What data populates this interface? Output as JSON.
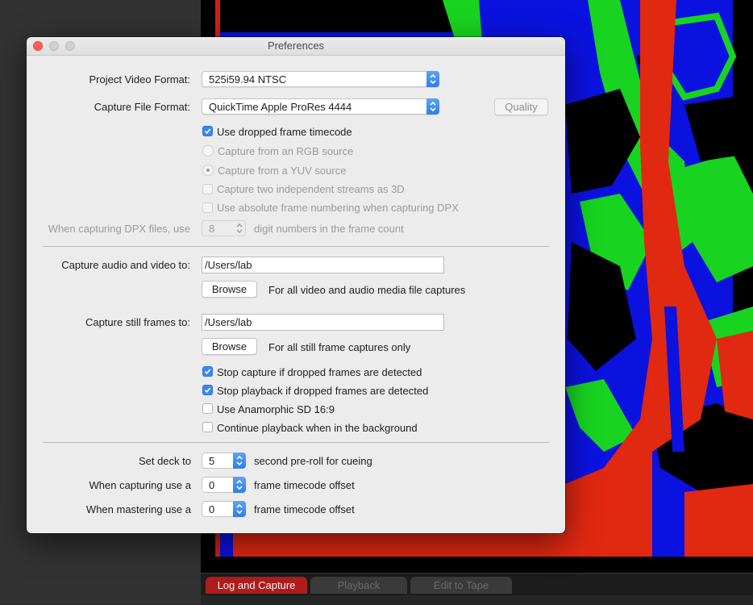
{
  "window": {
    "title": "Preferences"
  },
  "format": {
    "project_video_label": "Project Video Format:",
    "project_video_value": "525i59.94 NTSC",
    "capture_file_label": "Capture File Format:",
    "capture_file_value": "QuickTime Apple ProRes 4444",
    "quality_button": "Quality"
  },
  "options": {
    "dropped_frame_timecode": {
      "label": "Use dropped frame timecode",
      "checked": true,
      "enabled": true
    },
    "rgb_source": {
      "label": "Capture from an RGB source",
      "selected": false,
      "enabled": false
    },
    "yuv_source": {
      "label": "Capture from a YUV source",
      "selected": true,
      "enabled": false
    },
    "streams_3d": {
      "label": "Capture two independent streams as 3D",
      "checked": false,
      "enabled": false
    },
    "absolute_numbering": {
      "label": "Use absolute frame numbering when capturing DPX",
      "checked": false,
      "enabled": false
    }
  },
  "dpx": {
    "prefix": "When capturing DPX files, use",
    "digits": "8",
    "suffix": "digit numbers in the frame count"
  },
  "capture_paths": {
    "av_label": "Capture audio and video to:",
    "av_path": "/Users/lab",
    "av_browse": "Browse",
    "av_hint": "For all video and audio media file captures",
    "still_label": "Capture still frames to:",
    "still_path": "/Users/lab",
    "still_browse": "Browse",
    "still_hint": "For all still frame captures only"
  },
  "behaviour": {
    "stop_capture": {
      "label": "Stop capture if dropped frames are detected",
      "checked": true
    },
    "stop_playback": {
      "label": "Stop playback if dropped frames are detected",
      "checked": true
    },
    "anamorphic": {
      "label": "Use Anamorphic SD 16:9",
      "checked": false
    },
    "background_playback": {
      "label": "Continue playback when in the background",
      "checked": false
    }
  },
  "deck": {
    "preroll_label": "Set deck to",
    "preroll_value": "5",
    "preroll_suffix": "second pre-roll for cueing",
    "capture_offset_label": "When capturing use a",
    "capture_offset_value": "0",
    "capture_offset_suffix": "frame timecode offset",
    "master_offset_label": "When mastering use a",
    "master_offset_value": "0",
    "master_offset_suffix": "frame timecode offset"
  },
  "app_tabs": [
    "Log and Capture",
    "Playback",
    "Edit to Tape"
  ],
  "colors": {
    "accent": "#3b86f5",
    "active_tab": "#b01c1c",
    "close_light": "#fc5f57"
  }
}
